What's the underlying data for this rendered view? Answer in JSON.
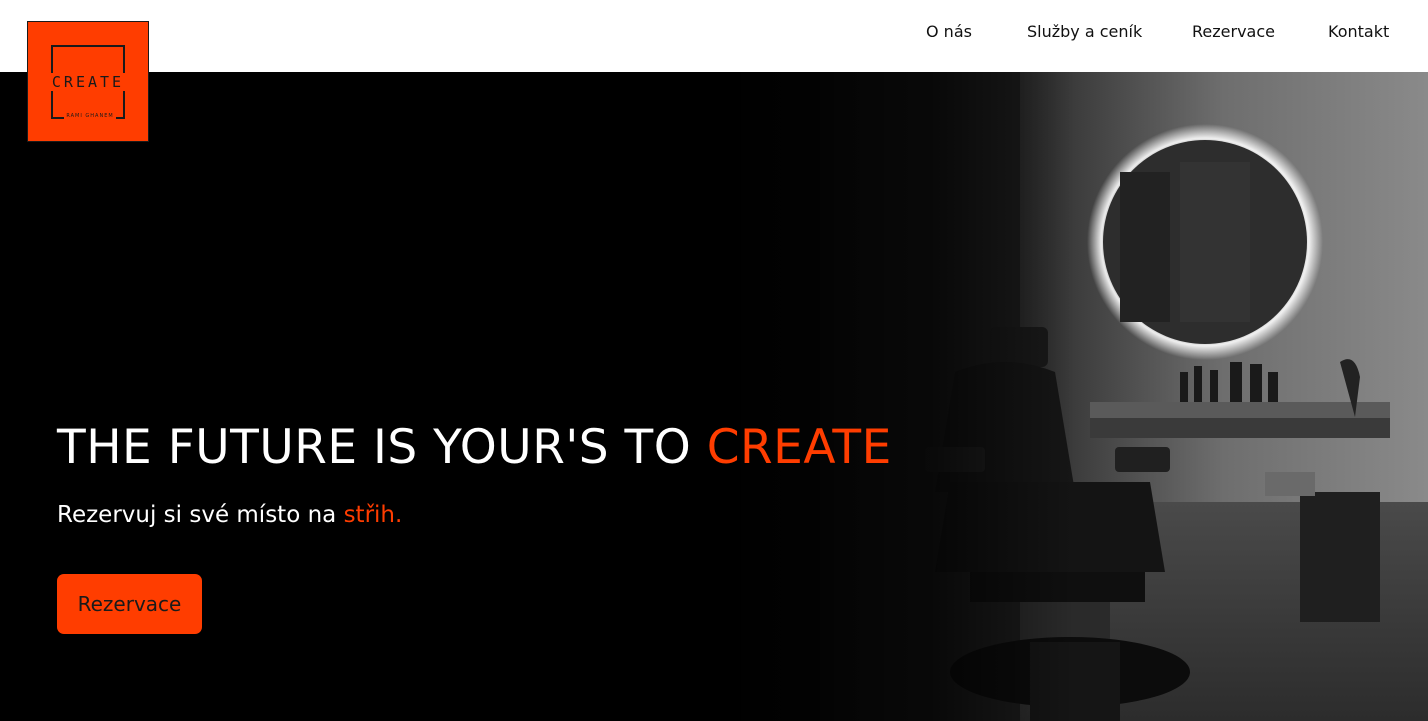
{
  "brand": {
    "logo_word": "CREATE",
    "logo_sub": "RAMI GHANEM",
    "accent_color": "#ff3d00"
  },
  "nav": {
    "items": [
      {
        "label": "O nás"
      },
      {
        "label": "Služby a ceník"
      },
      {
        "label": "Rezervace"
      },
      {
        "label": "Kontakt"
      }
    ]
  },
  "hero": {
    "headline_main": "THE FUTURE IS YOUR'S TO ",
    "headline_accent": "CREATE",
    "subline_main": "Rezervuj si své místo na ",
    "subline_accent": "střih.",
    "cta_label": "Rezervace",
    "background_image": "barbershop-interior-photo"
  }
}
